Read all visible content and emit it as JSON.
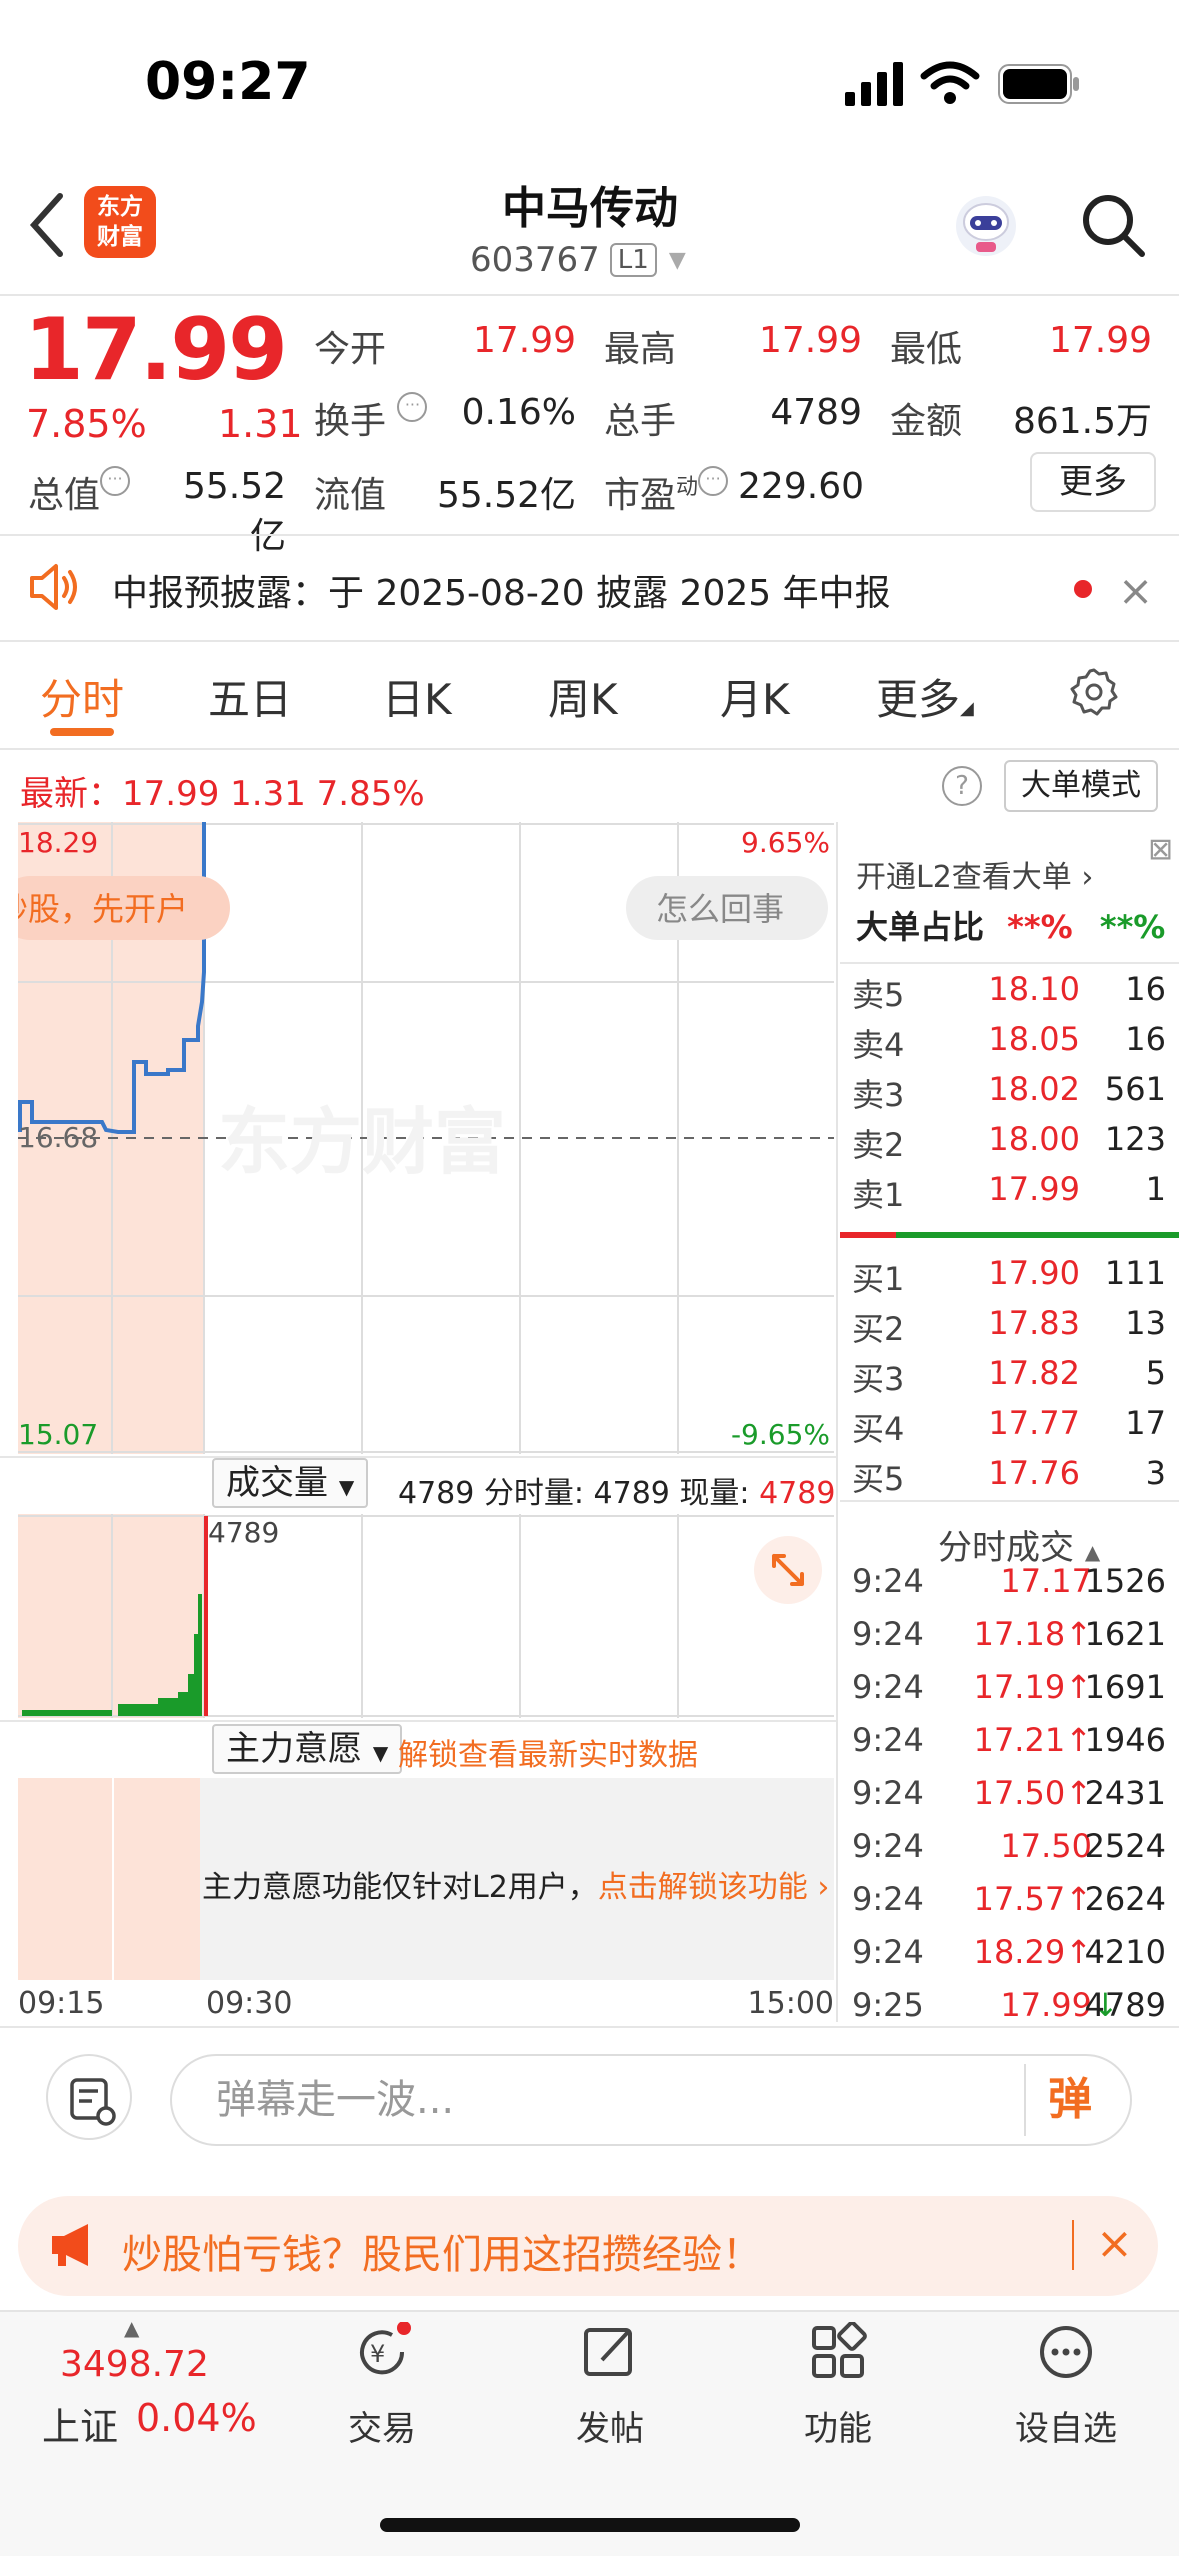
{
  "status": {
    "time": "09:27"
  },
  "header": {
    "logo": "东方\n财富",
    "stock_name": "中马传动",
    "stock_code": "603767",
    "level": "L1"
  },
  "quote": {
    "price": "17.99",
    "change_pct": "7.85%",
    "change": "1.31",
    "fields": [
      {
        "label": "今开",
        "value": "17.99",
        "color": "red"
      },
      {
        "label": "最高",
        "value": "17.99",
        "color": "red"
      },
      {
        "label": "最低",
        "value": "17.99",
        "color": "red"
      },
      {
        "label": "换手",
        "value": "0.16%",
        "color": "black"
      },
      {
        "label": "总手",
        "value": "4789",
        "color": "black"
      },
      {
        "label": "金额",
        "value": "861.5万",
        "color": "black"
      },
      {
        "label": "总值",
        "value": "55.52亿",
        "color": "black"
      },
      {
        "label": "流值",
        "value": "55.52亿",
        "color": "black"
      },
      {
        "label": "市盈",
        "value": "229.60",
        "color": "black"
      }
    ],
    "pe_superscript": "动",
    "more": "更多"
  },
  "notice": {
    "text": "中报预披露：于 2025-08-20 披露 2025 年中报"
  },
  "tabs": [
    "分时",
    "五日",
    "日K",
    "周K",
    "月K",
    "更多"
  ],
  "latest": {
    "text": "最新：17.99   1.31   7.85%",
    "mode": "大单模式"
  },
  "chart": {
    "top_price": "18.29",
    "mid_price": "16.68",
    "bottom_price": "15.07",
    "top_pct": "9.65%",
    "bottom_pct": "-9.65%",
    "pill_left": "炒股，先开户",
    "pill_right": "怎么回事",
    "watermark": "东方财富"
  },
  "orderbook": {
    "l2_link": "开通L2查看大单 ›",
    "ratio_label": "大单占比",
    "ratio_red": "**%",
    "ratio_green": "**%",
    "asks": [
      {
        "label": "卖5",
        "price": "18.10",
        "vol": "16"
      },
      {
        "label": "卖4",
        "price": "18.05",
        "vol": "16"
      },
      {
        "label": "卖3",
        "price": "18.02",
        "vol": "561"
      },
      {
        "label": "卖2",
        "price": "18.00",
        "vol": "123"
      },
      {
        "label": "卖1",
        "price": "17.99",
        "vol": "1"
      }
    ],
    "bids": [
      {
        "label": "买1",
        "price": "17.90",
        "vol": "111"
      },
      {
        "label": "买2",
        "price": "17.83",
        "vol": "13"
      },
      {
        "label": "买3",
        "price": "17.82",
        "vol": "5"
      },
      {
        "label": "买4",
        "price": "17.77",
        "vol": "17"
      },
      {
        "label": "买5",
        "price": "17.76",
        "vol": "3"
      }
    ]
  },
  "volume": {
    "label": "成交量",
    "stats_prefix": "4789 分时量: 4789 现量: ",
    "current": "4789",
    "bar_label": "4789"
  },
  "zhuli": {
    "label": "主力意愿",
    "unlock": "解锁查看最新实时数据",
    "msg": "主力意愿功能仅针对L2用户，",
    "msg_link": "点击解锁该功能 ›"
  },
  "time_axis": [
    "09:15",
    "09:30",
    "15:00"
  ],
  "trades": {
    "title": "分时成交",
    "rows": [
      {
        "t": "9:24",
        "p": "17.17",
        "v": "1526"
      },
      {
        "t": "9:24",
        "p": "17.18↑",
        "v": "1621"
      },
      {
        "t": "9:24",
        "p": "17.19↑",
        "v": "1691"
      },
      {
        "t": "9:24",
        "p": "17.21↑",
        "v": "1946"
      },
      {
        "t": "9:24",
        "p": "17.50↑",
        "v": "2431"
      },
      {
        "t": "9:24",
        "p": "17.50",
        "v": "2524"
      },
      {
        "t": "9:24",
        "p": "17.57↑",
        "v": "2624"
      },
      {
        "t": "9:24",
        "p": "18.29↑",
        "v": "4210"
      },
      {
        "t": "9:25",
        "p": "17.99↓",
        "v": "4789"
      }
    ]
  },
  "comment": {
    "placeholder": "弹幕走一波...",
    "send": "弹"
  },
  "ad": {
    "text": "炒股怕亏钱？股民们用这招攒经验！"
  },
  "nav": {
    "index_value": "3498.72",
    "index_name": "上证",
    "index_pct": "0.04%",
    "items": [
      "交易",
      "发帖",
      "功能",
      "设自选"
    ]
  }
}
